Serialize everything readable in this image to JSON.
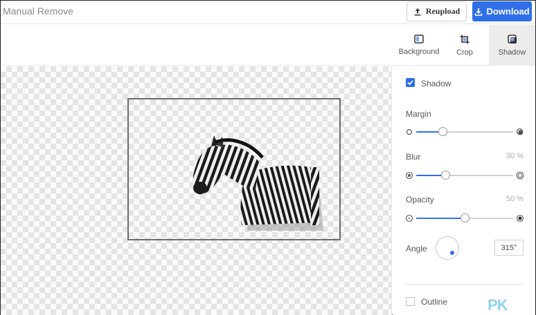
{
  "header": {
    "title": "Manual Remove",
    "reupload_label": "Reupload",
    "download_label": "Download"
  },
  "toolbar": {
    "tools": [
      {
        "label": "Background",
        "icon": "background-icon"
      },
      {
        "label": "Crop",
        "icon": "crop-icon"
      },
      {
        "label": "Shadow",
        "icon": "shadow-icon",
        "active": true
      }
    ]
  },
  "panel": {
    "shadow_label": "Shadow",
    "shadow_checked": true,
    "margin": {
      "label": "Margin",
      "value_fraction": 0.27
    },
    "blur": {
      "label": "Blur",
      "value": "30 %",
      "value_fraction": 0.3
    },
    "opacity": {
      "label": "Opacity",
      "value": "50 %",
      "value_fraction": 0.5
    },
    "angle": {
      "label": "Angle",
      "value": "315°"
    },
    "outline_label": "Outline",
    "outline_checked": false
  },
  "watermark": "PK",
  "colors": {
    "accent": "#2f6fe8",
    "active_tool_bg": "#ececec"
  }
}
